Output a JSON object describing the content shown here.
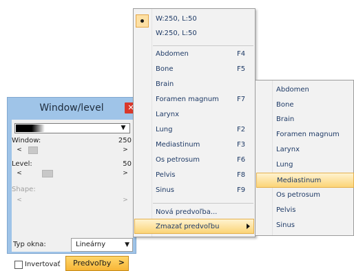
{
  "panel": {
    "title": "Window/level",
    "close_icon": "close-icon",
    "window_label": "Window:",
    "window_value": "250",
    "level_label": "Level:",
    "level_value": "50",
    "shape_label": "Shape:",
    "window_type_label": "Typ okna:",
    "window_type_value": "Lineárny",
    "invert_label": "Invertovať",
    "invert_checked": false,
    "presets_button": "Predvoľby",
    "accent_color": "#f7b637",
    "titlebar_color": "#9fc4e8"
  },
  "menu": {
    "items": [
      {
        "label": "W:250, L:50",
        "checked": true
      },
      {
        "label": "W:250, L:50"
      },
      {
        "label": "Abdomen",
        "shortcut": "F4"
      },
      {
        "label": "Bone",
        "shortcut": "F5"
      },
      {
        "label": "Brain"
      },
      {
        "label": "Foramen magnum",
        "shortcut": "F7"
      },
      {
        "label": "Larynx"
      },
      {
        "label": "Lung",
        "shortcut": "F2"
      },
      {
        "label": "Mediastinum",
        "shortcut": "F3"
      },
      {
        "label": "Os petrosum",
        "shortcut": "F6"
      },
      {
        "label": "Pelvis",
        "shortcut": "F8"
      },
      {
        "label": "Sinus",
        "shortcut": "F9"
      },
      {
        "label": "Nová predvoľba..."
      },
      {
        "label": "Zmazať predvoľbu",
        "highlighted": true,
        "has_submenu": true
      }
    ]
  },
  "submenu": {
    "items": [
      {
        "label": "Abdomen"
      },
      {
        "label": "Bone"
      },
      {
        "label": "Brain"
      },
      {
        "label": "Foramen magnum"
      },
      {
        "label": "Larynx"
      },
      {
        "label": "Lung"
      },
      {
        "label": "Mediastinum",
        "highlighted": true
      },
      {
        "label": "Os petrosum"
      },
      {
        "label": "Pelvis"
      },
      {
        "label": "Sinus"
      }
    ]
  }
}
